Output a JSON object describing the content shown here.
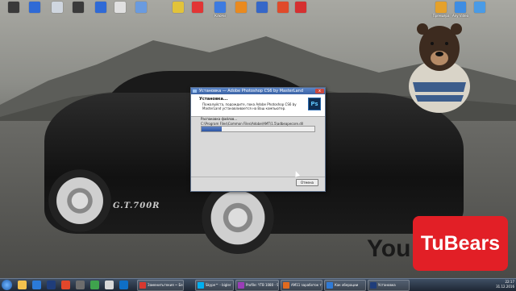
{
  "wallpaper": {
    "car_stripe": "G.T.700R",
    "watermark_text": "You",
    "logo_text": "TuBears"
  },
  "desktop_icons": [
    {
      "label": "",
      "color": "#3a3a3a"
    },
    {
      "label": "",
      "color": "#2f6ad6"
    },
    {
      "label": "",
      "color": "#cfd6df"
    },
    {
      "label": "",
      "color": "#3a3a3a"
    },
    {
      "label": "",
      "color": "#2f6ad6"
    },
    {
      "label": "",
      "color": "#e0e0e0"
    },
    {
      "label": "",
      "color": "#6a9be0"
    },
    {
      "label": "",
      "color": "#e2c33a"
    },
    {
      "label": "",
      "color": "#e23535"
    },
    {
      "label": "Ключи",
      "color": "#3d7be0"
    },
    {
      "label": "",
      "color": "#e98a1f"
    },
    {
      "label": "",
      "color": "#3567c8"
    },
    {
      "label": "",
      "color": "#e04a2a"
    },
    {
      "label": "",
      "color": "#d53030"
    },
    {
      "label": "Премьера",
      "color": "#e5a12b"
    },
    {
      "label": "Any Video",
      "color": "#3e8de3"
    },
    {
      "label": "",
      "color": "#4a9be6"
    }
  ],
  "dialog": {
    "title": "Установка — Adobe Photoshop CS6 by MasterLand",
    "close_label": "x",
    "heading": "Установка...",
    "subtitle": "Пожалуйста, подождите, пока Adobe Photoshop CS6 by MasterLand устанавливается на Ваш компьютер.",
    "status": "Распаковка файлов...",
    "path": "C:\\Program Files\\Common Files\\Adobe\\AMT\\1.5\\adbeapecore.dll",
    "progress_pct": 18,
    "cancel_label": "Отмена",
    "logo_text": "Ps"
  },
  "taskbar": {
    "tasks": [
      {
        "label": "Заменитьтекия ~ Бе",
        "color": "#d9382f"
      },
      {
        "label": "Skype™ - bigler",
        "color": "#00aff0"
      },
      {
        "label": "Profile: YTB 1080 - Sh",
        "color": "#9b3db7"
      },
      {
        "label": "AM11 заработок ты",
        "color": "#e06a1f"
      },
      {
        "label": "Как оберации",
        "color": "#2f7ad6"
      },
      {
        "label": "Установка",
        "color": "#1f3d7a"
      }
    ],
    "tray_time": "22:17",
    "tray_date": "31.12.2016"
  }
}
